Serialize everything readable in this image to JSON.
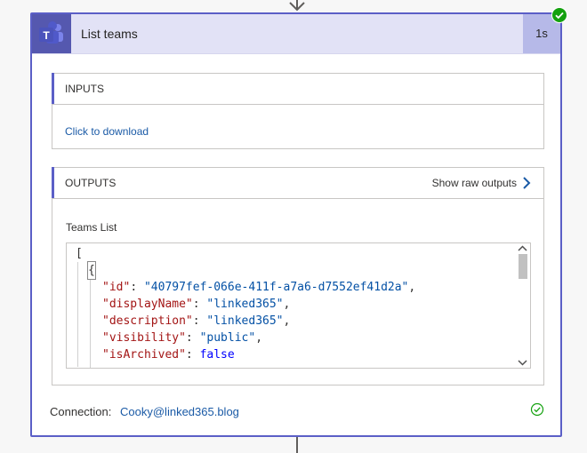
{
  "action": {
    "title": "List teams",
    "duration": "1s"
  },
  "inputs": {
    "title": "INPUTS",
    "download_link": "Click to download"
  },
  "outputs": {
    "title": "OUTPUTS",
    "show_raw_label": "Show raw outputs",
    "field_label": "Teams List",
    "json_lines": [
      {
        "open": "["
      },
      {
        "brace": "{"
      },
      {
        "key": "\"id\"",
        "sep": ": ",
        "value": "\"40797fef-066e-411f-a7a6-d7552ef41d2a\"",
        "tail": ","
      },
      {
        "key": "\"displayName\"",
        "sep": ": ",
        "value": "\"linked365\"",
        "tail": ","
      },
      {
        "key": "\"description\"",
        "sep": ": ",
        "value": "\"linked365\"",
        "tail": ","
      },
      {
        "key": "\"visibility\"",
        "sep": ": ",
        "value": "\"public\"",
        "tail": ","
      },
      {
        "key": "\"isArchived\"",
        "sep": ": ",
        "value": "false",
        "tail": ""
      }
    ]
  },
  "connection": {
    "label": "Connection:",
    "account": "Cooky@linked365.blog"
  },
  "colors": {
    "accent": "#5b5fc7",
    "header_bg": "#e2e2f6",
    "success": "#13a10e",
    "link": "#1a5aa6"
  }
}
